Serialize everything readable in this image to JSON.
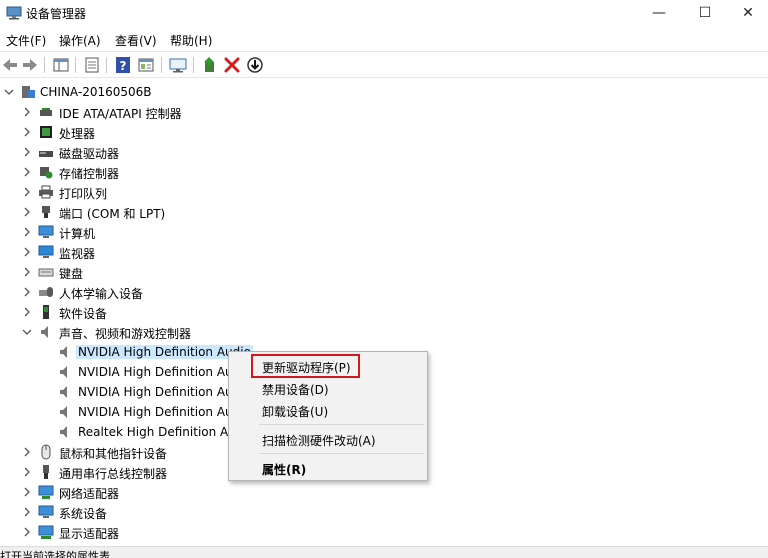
{
  "window": {
    "title": "设备管理器",
    "controls": {
      "minimize": "—",
      "maximize": "☐",
      "close": "✕"
    }
  },
  "menu": [
    "文件(F)",
    "操作(A)",
    "查看(V)",
    "帮助(H)"
  ],
  "toolbar": {
    "buttons": [
      "back-icon",
      "forward-icon",
      "show-hide-console-tree-icon",
      "properties-icon",
      "help-icon",
      "view-icon",
      "display-icon",
      "update-driver-icon",
      "uninstall-icon",
      "download-icon"
    ]
  },
  "tree": {
    "root": "CHINA-20160506B",
    "categories": [
      "IDE ATA/ATAPI 控制器",
      "处理器",
      "磁盘驱动器",
      "存储控制器",
      "打印队列",
      "端口 (COM 和 LPT)",
      "计算机",
      "监视器",
      "键盘",
      "人体学输入设备",
      "软件设备",
      "声音、视频和游戏控制器",
      "鼠标和其他指针设备",
      "通用串行总线控制器",
      "网络适配器",
      "系统设备",
      "显示适配器"
    ],
    "audio_children": [
      "NVIDIA High Definition Audio",
      "NVIDIA High Definition Au",
      "NVIDIA High Definition Au",
      "NVIDIA High Definition Au",
      "Realtek High Definition Au"
    ]
  },
  "context_menu": {
    "items": [
      "更新驱动程序(P)",
      "禁用设备(D)",
      "卸载设备(U)",
      "扫描检测硬件改动(A)",
      "属性(R)"
    ]
  },
  "status": {
    "text": "打开当前选择的属性表"
  },
  "colors": {
    "highlight_box": "#d2191d",
    "selection": "#cce8ff"
  }
}
